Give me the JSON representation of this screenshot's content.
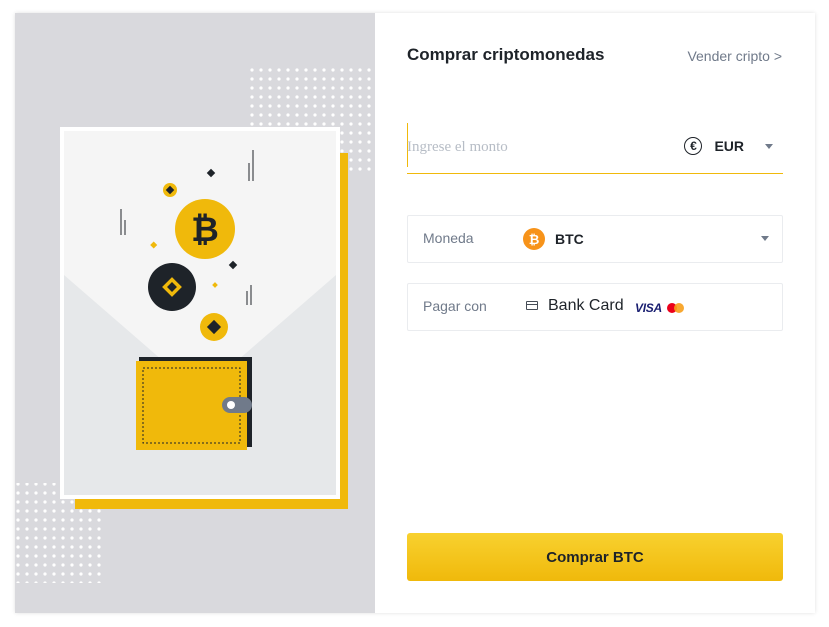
{
  "header": {
    "title": "Comprar criptomonedas",
    "sell_link": "Vender cripto >"
  },
  "amount": {
    "value": "",
    "placeholder": "Ingrese el monto",
    "currency_icon": "€",
    "currency_code": "EUR"
  },
  "coin": {
    "label": "Moneda",
    "icon_glyph": "₿",
    "code": "BTC"
  },
  "payment": {
    "label": "Pagar con",
    "method": "Bank Card",
    "visa": "VISA"
  },
  "buy_button": "Comprar BTC",
  "colors": {
    "accent": "#f0b90b",
    "bitcoin": "#f7931a",
    "text": "#1e2329",
    "muted": "#707a8a"
  },
  "illustration": {
    "icons": [
      "bitcoin-coin-icon",
      "binance-coin-icon",
      "wallet-icon",
      "envelope-icon"
    ]
  }
}
